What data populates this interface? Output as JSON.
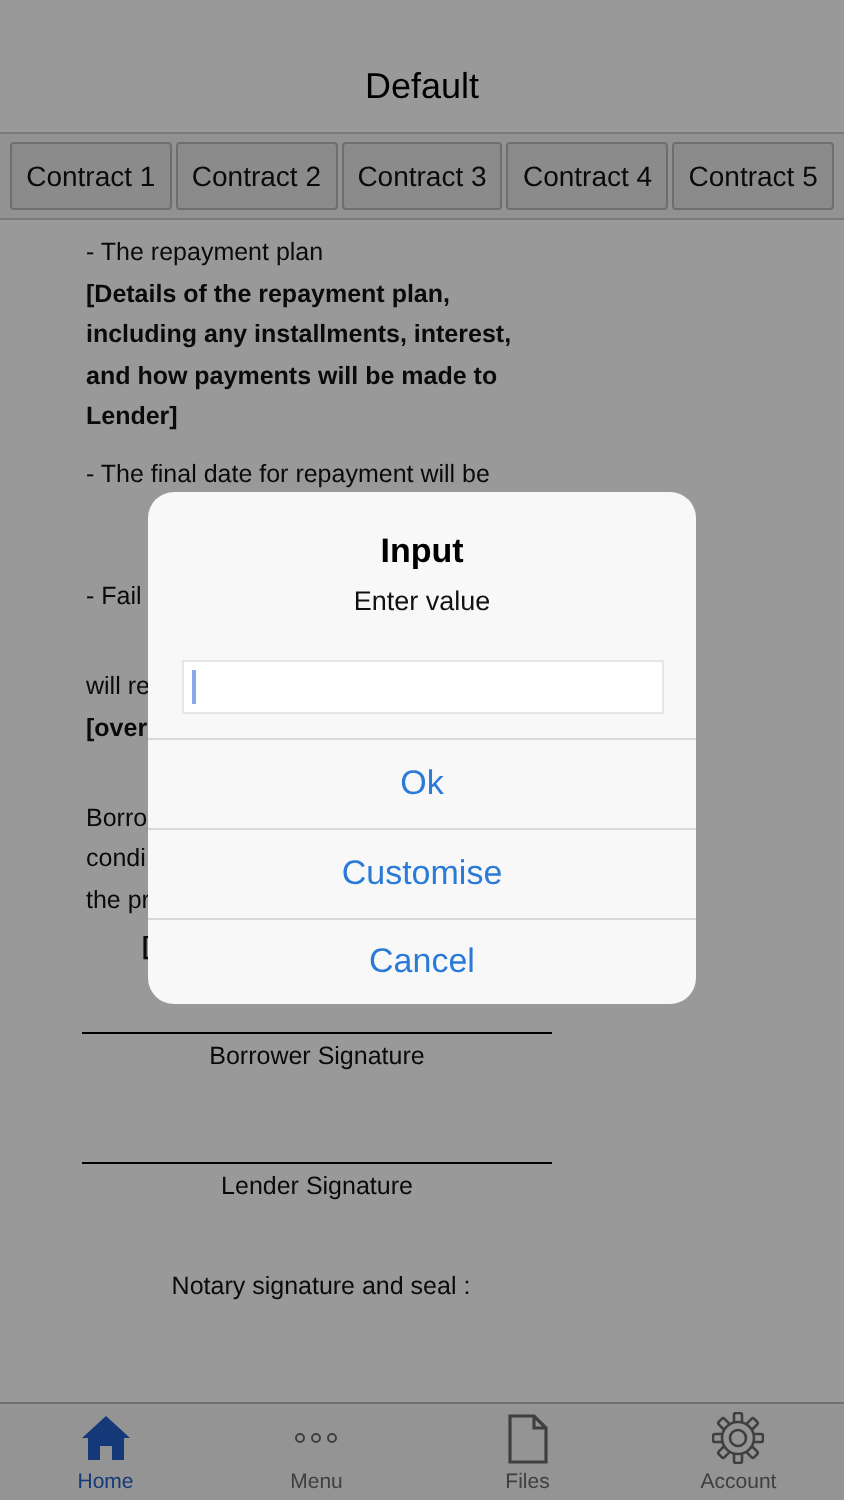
{
  "header": {
    "title": "Default"
  },
  "contracts": [
    {
      "label": "Contract 1"
    },
    {
      "label": "Contract 2"
    },
    {
      "label": "Contract 3"
    },
    {
      "label": "Contract 4"
    },
    {
      "label": "Contract 5"
    }
  ],
  "document": {
    "paragraphs": [
      {
        "lines": [
          {
            "text": "- The repayment plan",
            "bold": false
          },
          {
            "text": "[Details of the repayment plan,",
            "bold": true
          },
          {
            "text": "including any installments, interest,",
            "bold": true
          },
          {
            "text": "and how payments will be made to",
            "bold": true
          },
          {
            "text": "Lender]",
            "bold": true
          }
        ]
      },
      {
        "lines": [
          {
            "text": "- The final date for repayment will be",
            "bold": false
          }
        ]
      },
      {
        "lines": [
          {
            "text": "- Fail",
            "bold": false
          }
        ]
      },
      {
        "lines": [
          {
            "text": "will re",
            "bold": false
          },
          {
            "text": "[over",
            "bold": true
          }
        ]
      },
      {
        "lines": [
          {
            "text": "Borro",
            "bold": false
          },
          {
            "text": "condi",
            "bold": false
          },
          {
            "text": "the pr",
            "bold": false
          },
          {
            "text": "[",
            "bold": true
          }
        ]
      }
    ],
    "signatures": [
      {
        "label": "Borrower Signature"
      },
      {
        "label": "Lender Signature"
      }
    ],
    "notary": "Notary signature and seal :"
  },
  "dialog": {
    "title": "Input",
    "message": "Enter value",
    "actions": [
      {
        "label": "Ok"
      },
      {
        "label": "Customise"
      },
      {
        "label": "Cancel"
      }
    ]
  },
  "tab_bar": [
    {
      "label": "Home",
      "kind": "home",
      "selected": true
    },
    {
      "label": "Menu",
      "kind": "dots",
      "selected": false
    },
    {
      "label": "Files",
      "kind": "file",
      "selected": false
    },
    {
      "label": "Account",
      "kind": "gear",
      "selected": false
    }
  ]
}
